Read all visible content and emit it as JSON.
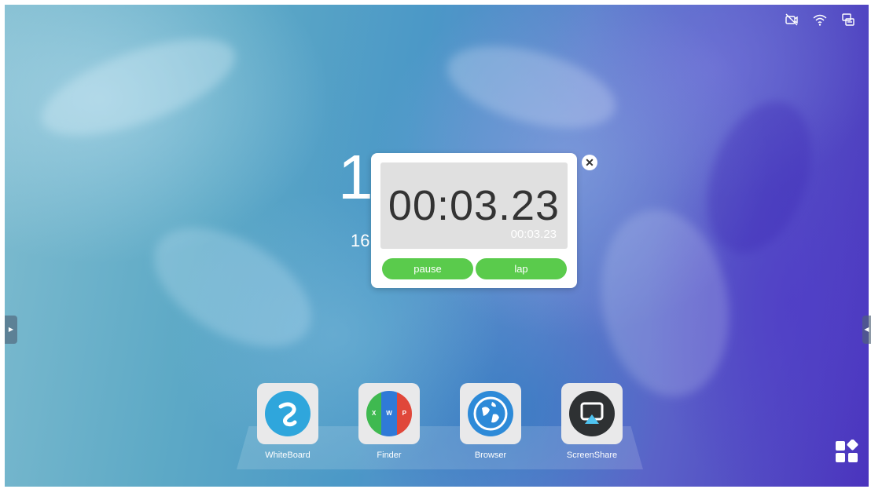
{
  "status_bar": {
    "icons": [
      "camera-off-icon",
      "wifi-icon",
      "screen-mirror-icon"
    ]
  },
  "clock": {
    "time": "1",
    "date": "16"
  },
  "stopwatch": {
    "display": "00:03.23",
    "lap_display": "00:03.23",
    "pause_label": "pause",
    "lap_label": "lap",
    "close_symbol": "✕",
    "button_color": "#5acb4c"
  },
  "side_tabs": {
    "left_symbol": "▶",
    "right_symbol": "◀"
  },
  "dock": {
    "apps": [
      {
        "label": "WhiteBoard",
        "icon": "whiteboard-icon",
        "color": "#2fa6dc"
      },
      {
        "label": "Finder",
        "icon": "finder-icon",
        "letters": [
          "X",
          "W",
          "P"
        ],
        "colors": [
          "#3fb950",
          "#2f7ad7",
          "#e0473a"
        ]
      },
      {
        "label": "Browser",
        "icon": "browser-globe-icon",
        "color": "#2d8ad8"
      },
      {
        "label": "ScreenShare",
        "icon": "screenshare-icon",
        "color": "#2e3133"
      }
    ]
  },
  "apps_grid_icon": "all-apps-icon"
}
